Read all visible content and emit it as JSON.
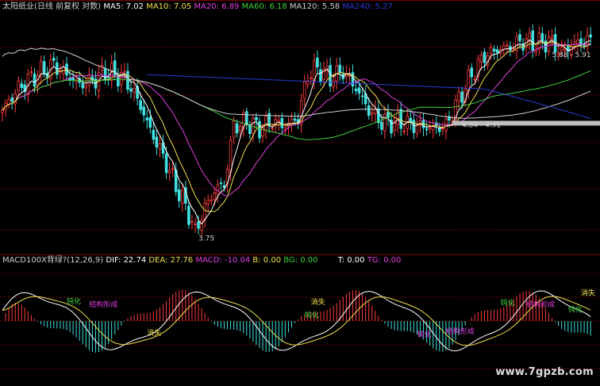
{
  "top_legend": [
    {
      "text": "太阳纸业(日线 前复权 对数)",
      "color": "#d0d0d0"
    },
    {
      "text": "MA5: 7.02",
      "color": "#ffffff"
    },
    {
      "text": "MA10: 7.05",
      "color": "#f0e050"
    },
    {
      "text": "MA20: 6.89",
      "color": "#e040e0"
    },
    {
      "text": "MA60: 6.18",
      "color": "#40d040"
    },
    {
      "text": "MA120: 5.58",
      "color": "#d0d0d0"
    },
    {
      "text": "MA240: 5.27",
      "color": "#2a3cd8"
    }
  ],
  "macd_legend": [
    {
      "text": "MACD100X背绿?(12,26,9)",
      "color": "#d0d0d0"
    },
    {
      "text": "DIF: 22.74",
      "color": "#ffffff"
    },
    {
      "text": "DEA: 27.76",
      "color": "#f0e050"
    },
    {
      "text": "MACD: -10.04",
      "color": "#e040e0"
    },
    {
      "text": "B: 0.00",
      "color": "#f0e050"
    },
    {
      "text": "BG: 0.00",
      "color": "#40d040"
    },
    {
      "text": "T: 0.00",
      "color": "#ffffff"
    },
    {
      "text": "TG: 0.00",
      "color": "#e040e0"
    }
  ],
  "watermark": "www.7gpzb.com",
  "colors": {
    "up": "#ff3c3c",
    "down": "#40e0e0",
    "ma5": "#ffffff",
    "ma10": "#f0e050",
    "ma20": "#e040e0",
    "ma60": "#40d040",
    "ma120": "#d0d0d0",
    "ma240": "#2a3cd8",
    "grid": "#7a0000"
  },
  "chart_data": [
    {
      "type": "candlestick",
      "title": "太阳纸业(日线 前复权 对数)",
      "anchors": [
        {
          "i": 0,
          "p": 6.3
        },
        {
          "i": 5,
          "p": 6.9
        },
        {
          "i": 9,
          "p": 7.2
        },
        {
          "i": 16,
          "p": 7.6
        },
        {
          "i": 20,
          "p": 7.3
        },
        {
          "i": 24,
          "p": 7.0
        },
        {
          "i": 28,
          "p": 7.1
        },
        {
          "i": 32,
          "p": 7.4
        },
        {
          "i": 38,
          "p": 7.2
        },
        {
          "i": 42,
          "p": 6.6
        },
        {
          "i": 46,
          "p": 5.8
        },
        {
          "i": 50,
          "p": 5.2
        },
        {
          "i": 54,
          "p": 4.6
        },
        {
          "i": 58,
          "p": 4.1
        },
        {
          "i": 60,
          "p": 3.8
        },
        {
          "i": 63,
          "p": 4.2
        },
        {
          "i": 67,
          "p": 4.6
        },
        {
          "i": 69,
          "p": 4.6
        },
        {
          "i": 72,
          "p": 5.9
        },
        {
          "i": 76,
          "p": 6.0
        },
        {
          "i": 80,
          "p": 5.85
        },
        {
          "i": 84,
          "p": 6.0
        },
        {
          "i": 88,
          "p": 5.9
        },
        {
          "i": 92,
          "p": 6.1
        },
        {
          "i": 95,
          "p": 7.3
        },
        {
          "i": 98,
          "p": 7.5
        },
        {
          "i": 102,
          "p": 7.2
        },
        {
          "i": 106,
          "p": 7.4
        },
        {
          "i": 110,
          "p": 6.9
        },
        {
          "i": 114,
          "p": 6.3
        },
        {
          "i": 118,
          "p": 6.0
        },
        {
          "i": 122,
          "p": 6.0
        },
        {
          "i": 126,
          "p": 5.95
        },
        {
          "i": 130,
          "p": 5.9
        },
        {
          "i": 134,
          "p": 5.85
        },
        {
          "i": 138,
          "p": 5.9
        },
        {
          "i": 142,
          "p": 6.6
        },
        {
          "i": 146,
          "p": 7.3
        },
        {
          "i": 150,
          "p": 7.9
        },
        {
          "i": 154,
          "p": 8.1
        },
        {
          "i": 158,
          "p": 8.2
        },
        {
          "i": 162,
          "p": 8.4
        },
        {
          "i": 166,
          "p": 8.3
        },
        {
          "i": 170,
          "p": 8.4
        },
        {
          "i": 174,
          "p": 8.0
        },
        {
          "i": 178,
          "p": 8.3
        },
        {
          "i": 182,
          "p": 8.4
        }
      ],
      "labels": [
        {
          "text": "3.75",
          "i": 60,
          "p": 3.72
        },
        {
          "text": "4.84 - 4.91",
          "i": 142,
          "p": 5.95
        },
        {
          "text": "5.88 - 5.91",
          "i": 170,
          "p": 7.95
        }
      ],
      "ylim": [
        3.5,
        9.5
      ]
    },
    {
      "type": "macd",
      "annotations": [
        {
          "text": "钝化",
          "i": 20,
          "v": 0.58,
          "color": "#40d040"
        },
        {
          "text": "结构形成",
          "i": 27,
          "v": 0.48,
          "color": "#e040e0"
        },
        {
          "text": "消失",
          "i": 45,
          "v": -0.48,
          "color": "#f0e050"
        },
        {
          "text": "消失",
          "i": 96,
          "v": 0.55,
          "color": "#f0e050"
        },
        {
          "text": "钝化",
          "i": 94,
          "v": 0.12,
          "color": "#40d040"
        },
        {
          "text": "结构形成",
          "i": 138,
          "v": -0.42,
          "color": "#e040e0"
        },
        {
          "text": "钝化",
          "i": 129,
          "v": -0.52,
          "color": "#e040e0"
        },
        {
          "text": "钝化",
          "i": 155,
          "v": 0.52,
          "color": "#40d040"
        },
        {
          "text": "结构形成",
          "i": 163,
          "v": 0.48,
          "color": "#e040e0"
        },
        {
          "text": "钝化",
          "i": 176,
          "v": 0.3,
          "color": "#40d040"
        },
        {
          "text": "消失",
          "i": 180,
          "v": 0.85,
          "color": "#f0e050"
        }
      ]
    }
  ]
}
